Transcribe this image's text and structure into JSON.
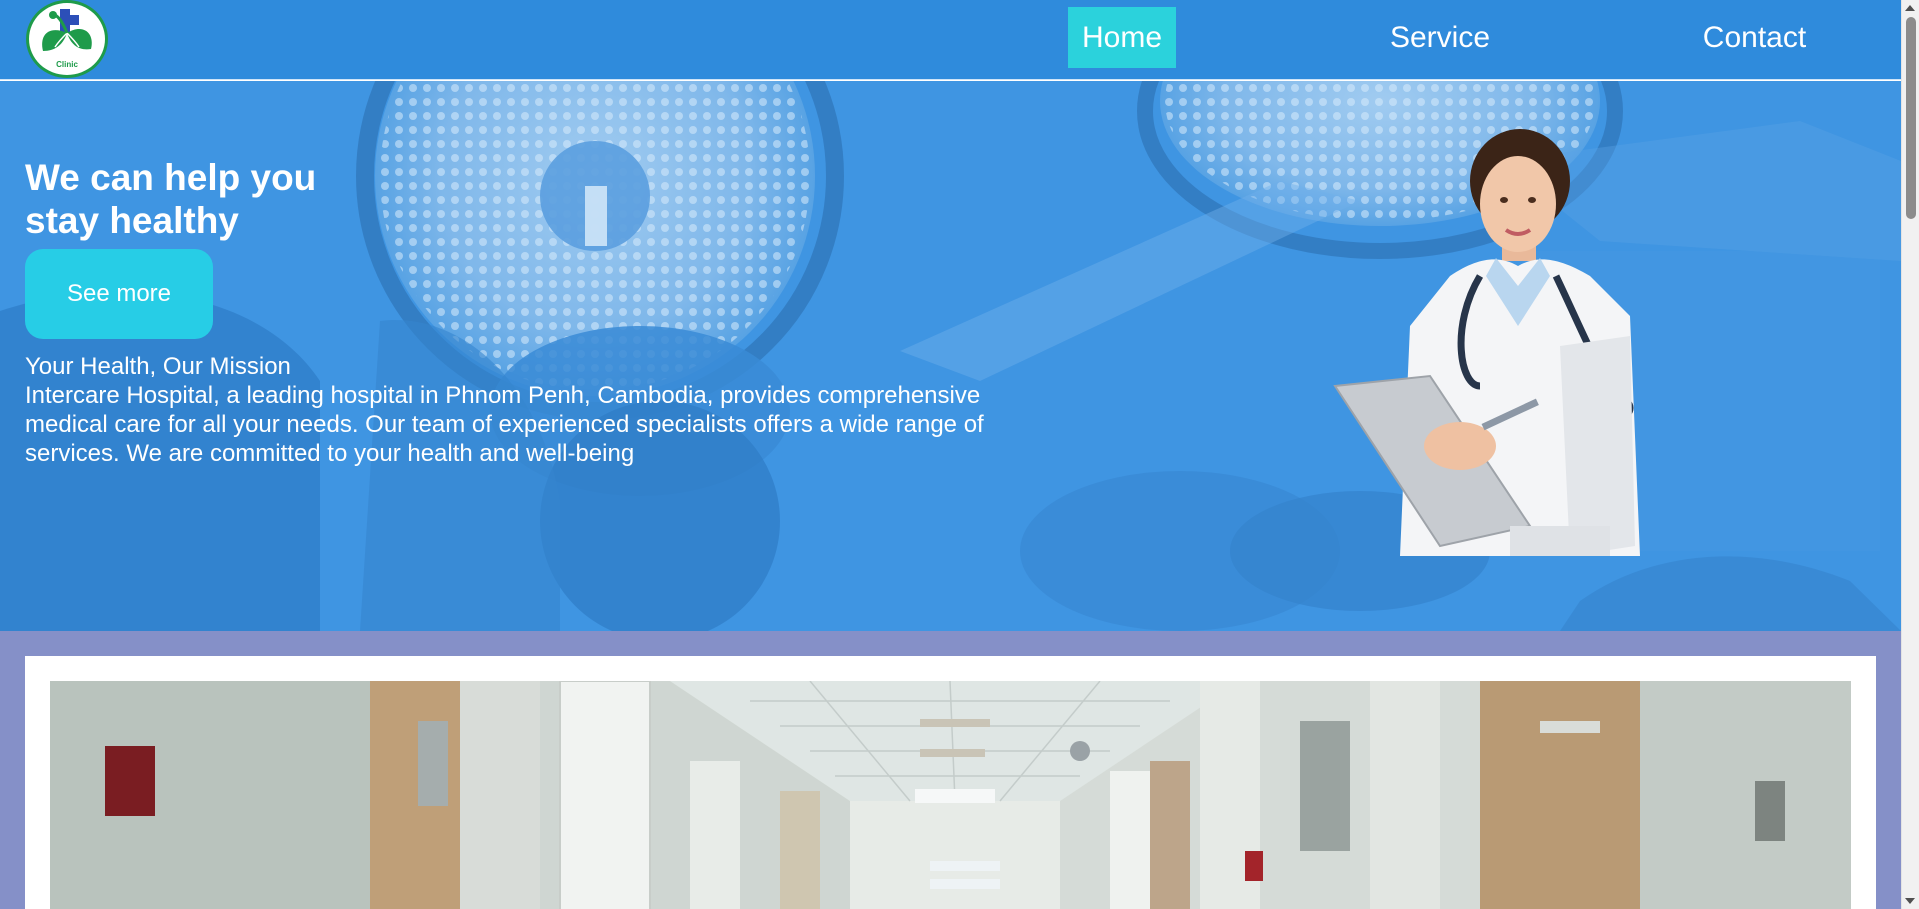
{
  "header": {
    "logo_text": "Clinic",
    "nav": [
      {
        "label": "Home",
        "active": true
      },
      {
        "label": "Service",
        "active": false
      },
      {
        "label": "Contact",
        "active": false
      }
    ]
  },
  "hero": {
    "title_line1": "We can help you",
    "title_line2": "stay healthy",
    "cta_label": "See more",
    "subtitle": "Your Health, Our Mission",
    "description": "Intercare Hospital, a leading hospital in Phnom Penh, Cambodia, provides comprehensive medical care for all your needs. Our team of experienced specialists offers a wide range of services. We are committed to your health and well-being"
  },
  "colors": {
    "header_bg": "#2f8bdc",
    "hero_bg": "#3d93e0",
    "nav_active_bg": "#2bd2dc",
    "cta_bg": "#27cde6",
    "gallery_bg": "#8590c8",
    "logo_green": "#1e9b4a"
  },
  "icons": {
    "logo": "clinic-leaf-cross-logo",
    "doctor": "doctor-with-clipboard-image",
    "gallery": "hospital-corridor-image"
  }
}
